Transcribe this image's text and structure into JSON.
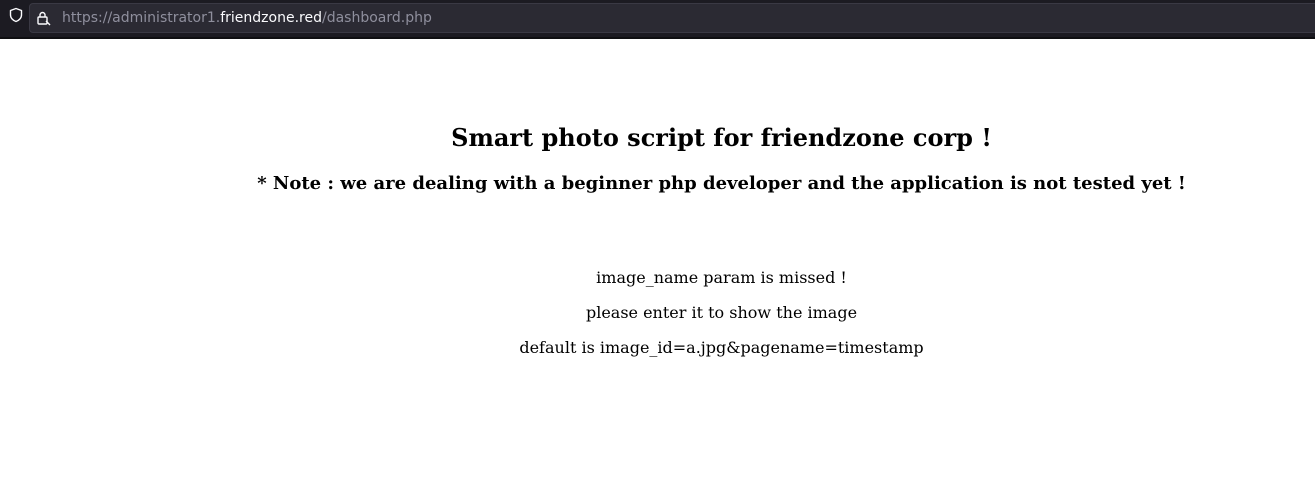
{
  "browser": {
    "url_prefix": "https://administrator1.",
    "url_domain": "friendzone.red",
    "url_path": "/dashboard.php",
    "icons": {
      "shield": "shield-icon",
      "lock": "lock-icon"
    },
    "colors": {
      "toolbar_bg": "#1c1b22",
      "urlbar_bg": "#2b2a33",
      "url_dim": "#8f8f9d",
      "url_domain": "#fbfbfe"
    }
  },
  "page": {
    "title": "Smart photo script for friendzone corp !",
    "note": "* Note : we are dealing with a beginner php developer and the application is not tested yet !",
    "messages": [
      "image_name param is missed !",
      "please enter it to show the image",
      "default is image_id=a.jpg&pagename=timestamp"
    ]
  }
}
